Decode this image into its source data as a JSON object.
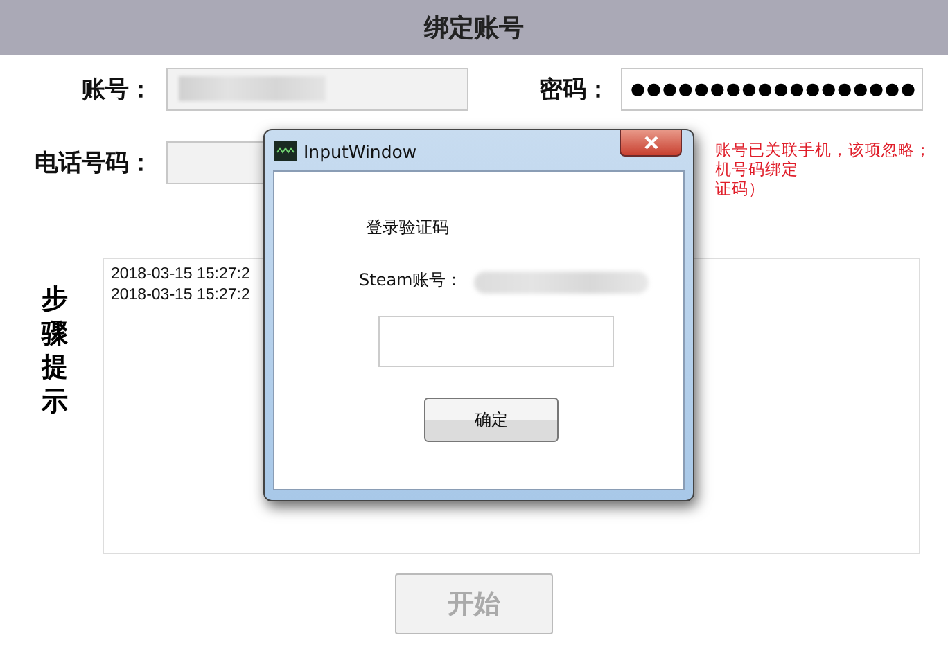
{
  "header": {
    "title": "绑定账号"
  },
  "form": {
    "account_label": "账号：",
    "password_label": "密码：",
    "password_value": "●●●●●●●●●●●●●●●●●●",
    "phone_label": "电话号码：",
    "note_lines": [
      "账号已关联手机，该项忽略；",
      "机号码绑定",
      "证码）"
    ]
  },
  "steps": {
    "label": "步骤提示",
    "log_lines": [
      "2018-03-15 15:27:2",
      "2018-03-15 15:27:2"
    ]
  },
  "start_button": {
    "label": "开始",
    "disabled": true
  },
  "dialog": {
    "title": "InputWindow",
    "heading": "登录验证码",
    "account_label": "Steam账号：",
    "ok_button": "确定"
  }
}
